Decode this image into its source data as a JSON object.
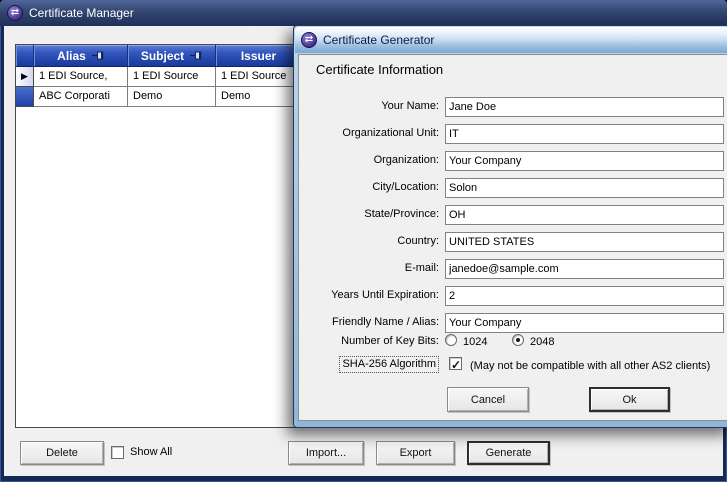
{
  "icons": {
    "app_logo_glyph": "⇄",
    "current_row_glyph": "▶"
  },
  "colors": {
    "window_frame": "#142a54",
    "main_titlebar_top": "#50659b",
    "main_titlebar_bottom": "#1f2f5b",
    "dialog_frame": "#9fc2e2",
    "grid_header_blue": "#2346ab",
    "client_gray": "#f0f0f0"
  },
  "main_window": {
    "title": "Certificate Manager",
    "grid": {
      "columns": [
        "Alias",
        "Subject",
        "Issuer"
      ],
      "rows": [
        {
          "alias": "1 EDI Source,",
          "subject": "1 EDI Source",
          "issuer": "1 EDI Source",
          "current": true
        },
        {
          "alias": "ABC Corporati",
          "subject": "Demo",
          "issuer": "Demo",
          "current": false
        }
      ]
    },
    "delete_label": "Delete",
    "show_all": {
      "label": "Show All",
      "checked": false
    },
    "import_label": "Import...",
    "export_label": "Export",
    "generate_label": "Generate"
  },
  "dialog": {
    "title": "Certificate Generator",
    "heading": "Certificate Information",
    "fields": [
      {
        "label": "Your Name:",
        "value": "Jane Doe"
      },
      {
        "label": "Organizational Unit:",
        "value": "IT"
      },
      {
        "label": "Organization:",
        "value": "Your Company"
      },
      {
        "label": "City/Location:",
        "value": "Solon"
      },
      {
        "label": "State/Province:",
        "value": "OH"
      },
      {
        "label": "Country:",
        "value": "UNITED STATES"
      },
      {
        "label": "E-mail:",
        "value": "janedoe@sample.com"
      },
      {
        "label": "Years Until Expiration:",
        "value": "2"
      },
      {
        "label": "Friendly Name / Alias:",
        "value": "Your Company"
      }
    ],
    "key_bits": {
      "label": "Number of Key Bits:",
      "options": [
        {
          "label": "1024",
          "selected": false
        },
        {
          "label": "2048",
          "selected": true
        }
      ]
    },
    "sha": {
      "label": "SHA-256 Algorithm",
      "checked": true,
      "note": "(May not be compatible with all other AS2 clients)"
    },
    "cancel_label": "Cancel",
    "ok_label": "Ok"
  }
}
